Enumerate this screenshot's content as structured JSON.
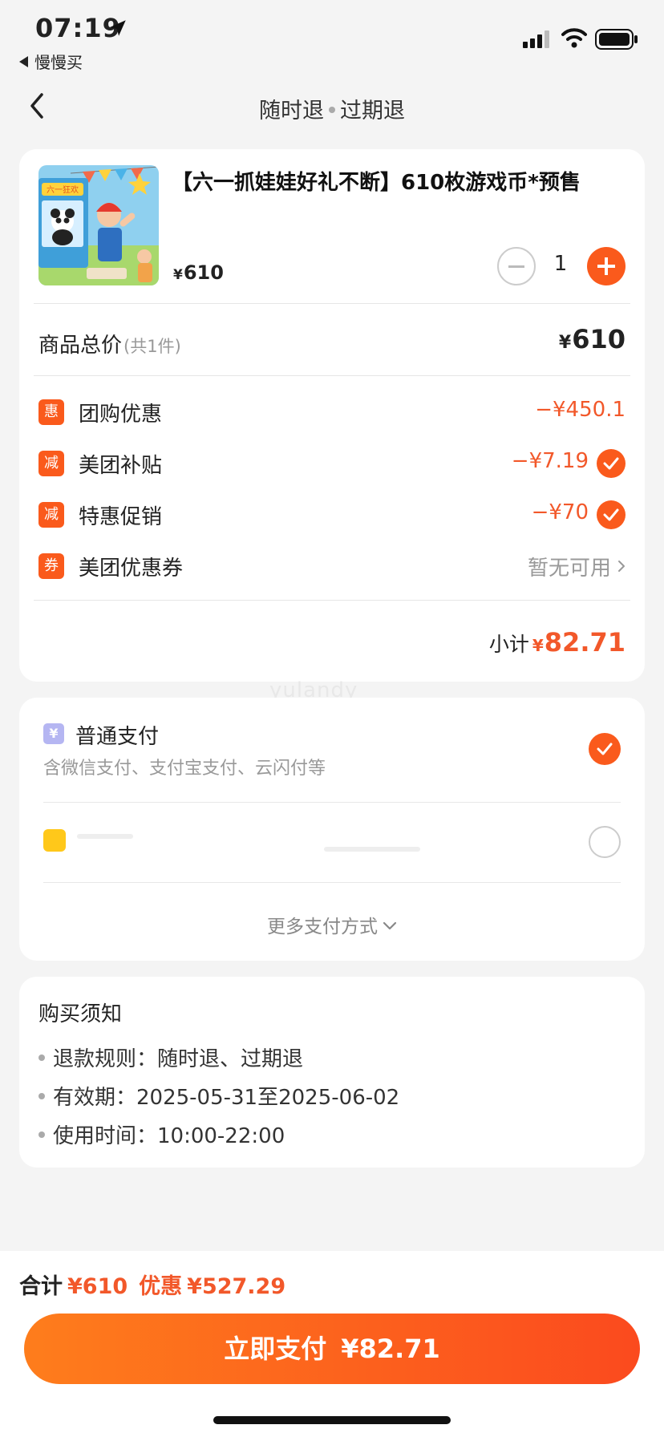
{
  "status_bar": {
    "time": "07:19",
    "back_app": "慢慢买"
  },
  "nav": {
    "title_part1": "随时退",
    "title_part2": "过期退"
  },
  "product": {
    "title": "【六一抓娃娃好礼不断】610枚游戏币*预售",
    "thumb_caption": "六一狂欢",
    "price_symbol": "¥",
    "price": "610",
    "quantity": "1"
  },
  "summary": {
    "total_label": "商品总价",
    "total_count": "(共1件)",
    "total_value": "610",
    "currency": "¥",
    "discounts": [
      {
        "badge": "惠",
        "label": "团购优惠",
        "value": "−¥450.1",
        "checked": false
      },
      {
        "badge": "减",
        "label": "美团补贴",
        "value": "−¥7.19",
        "checked": true
      },
      {
        "badge": "减",
        "label": "特惠促销",
        "value": "−¥70",
        "checked": true
      },
      {
        "badge": "券",
        "label": "美团优惠券",
        "value": "暂无可用",
        "checked": false
      }
    ],
    "subtotal_label": "小计",
    "subtotal_value": "82.71"
  },
  "watermark": "yulandy",
  "payment": {
    "icon_glyph": "¥",
    "method_title": "普通支付",
    "method_desc": "含微信支付、支付宝支付、云闪付等",
    "more_label": "更多支付方式"
  },
  "notice": {
    "title": "购买须知",
    "items": [
      "退款规则：随时退、过期退",
      "有效期：2025-05-31至2025-06-02",
      "使用时间：10:00-22:00"
    ]
  },
  "bottom": {
    "total_label": "合计",
    "total_value": "¥610",
    "discount_label": "优惠",
    "discount_value": "¥527.29",
    "button_label": "立即支付",
    "button_amount": "¥82.71"
  },
  "colors": {
    "accent": "#fa5a1c",
    "discount_text": "#f2582a",
    "background": "#f4f4f4"
  },
  "icons": [
    "location-arrow-icon",
    "signal-icon",
    "wifi-icon",
    "battery-icon",
    "back-chevron-icon",
    "minus-icon",
    "plus-icon",
    "check-icon",
    "chevron-right-icon",
    "chevron-down-icon",
    "payment-yen-icon"
  ]
}
